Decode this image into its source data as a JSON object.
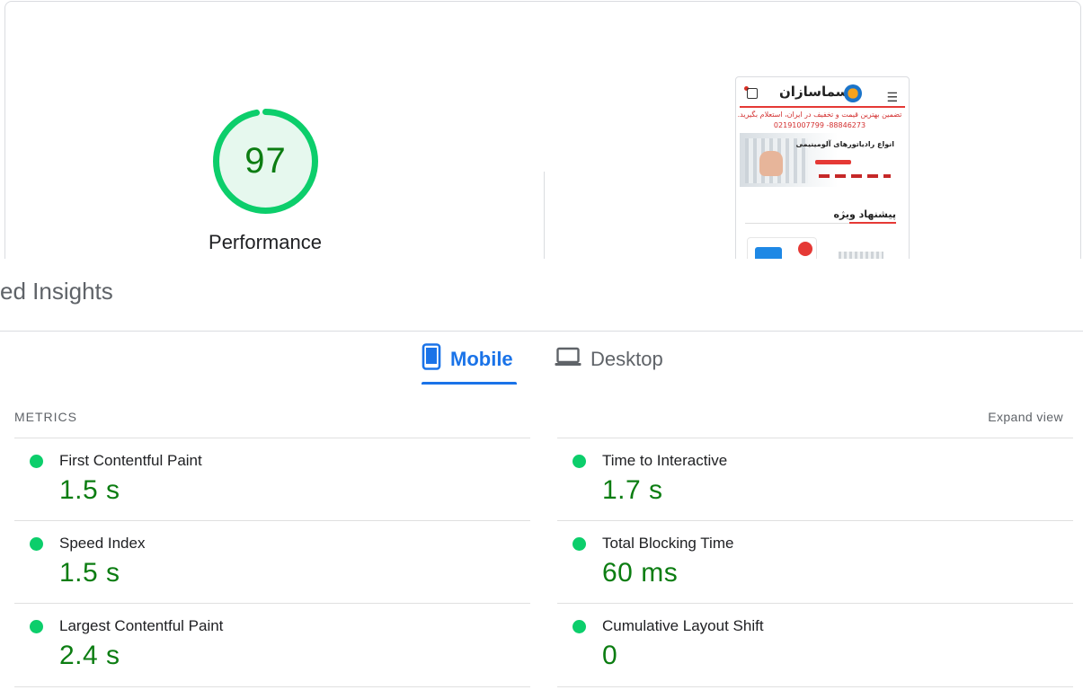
{
  "score": {
    "value": "97",
    "label": "Performance",
    "color": "#0cce6b",
    "score_fraction": 0.97
  },
  "preview": {
    "site_logo_text": "سماسازان",
    "promo_text": "تضمین بهترین قیمت و تخفیف در ایران، استعلام بگیرید.",
    "phone_text": "02191007799  -88846273",
    "banner_title": "انواع رادیاتورهای آلومینیمی",
    "section_title": "پیشنهاد ویژه"
  },
  "app": {
    "title": "ed Insights"
  },
  "tabs": [
    {
      "label": "Mobile",
      "icon": "smartphone-icon",
      "selected": true
    },
    {
      "label": "Desktop",
      "icon": "laptop-icon",
      "selected": false
    }
  ],
  "metrics": {
    "heading": "METRICS",
    "expand_label": "Expand view",
    "left": [
      {
        "name": "First Contentful Paint",
        "value": "1.5 s",
        "status": "good"
      },
      {
        "name": "Speed Index",
        "value": "1.5 s",
        "status": "good"
      },
      {
        "name": "Largest Contentful Paint",
        "value": "2.4 s",
        "status": "good"
      }
    ],
    "right": [
      {
        "name": "Time to Interactive",
        "value": "1.7 s",
        "status": "good"
      },
      {
        "name": "Total Blocking Time",
        "value": "60 ms",
        "status": "good"
      },
      {
        "name": "Cumulative Layout Shift",
        "value": "0",
        "status": "good"
      }
    ]
  },
  "colors": {
    "accent": "#1a73e8",
    "good": "#0cce6b",
    "good_text": "#0c7d12"
  }
}
